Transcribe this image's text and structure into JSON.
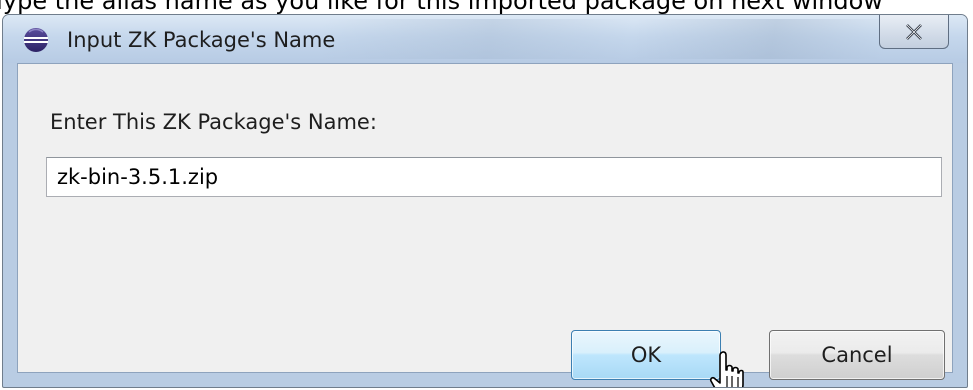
{
  "caption": "Type the alias name as you like for this imported package on next window",
  "dialog": {
    "title": "Input ZK Package's Name",
    "app_icon": "eclipse-icon",
    "close_icon": "close-icon",
    "prompt_label": "Enter This ZK Package's Name:",
    "name_input": {
      "value": "zk-bin-3.5.1.zip",
      "placeholder": ""
    },
    "buttons": {
      "ok_label": "OK",
      "cancel_label": "Cancel"
    }
  },
  "colors": {
    "frame": "#b9cce3",
    "client_bg": "#f0f0f0",
    "ok_button_border": "#3c7fb1"
  }
}
